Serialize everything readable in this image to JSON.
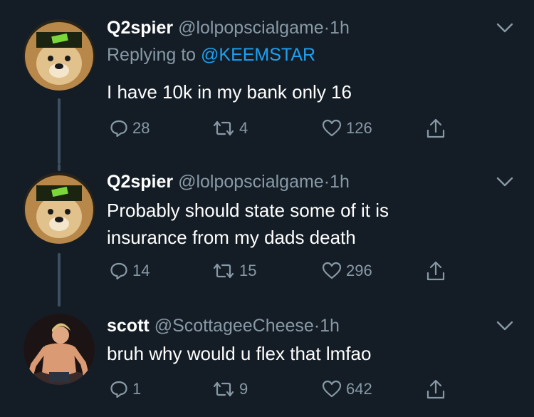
{
  "tweets": [
    {
      "name": "Q2spier",
      "handle": "@lolpopscialgame",
      "dot": "·",
      "time": "1h",
      "reply_prefix": "Replying to",
      "reply_to": "@KEEMSTAR",
      "text": "I have 10k in my bank only 16",
      "replies": "28",
      "retweets": "4",
      "likes": "126"
    },
    {
      "name": "Q2spier",
      "handle": "@lolpopscialgame",
      "dot": "·",
      "time": "1h",
      "text_lines": [
        "Probably should state some of it is",
        "insurance from my dads death"
      ],
      "replies": "14",
      "retweets": "15",
      "likes": "296"
    },
    {
      "name": "scott",
      "handle": "@ScottageeCheese",
      "dot": "·",
      "time": "1h",
      "text": "bruh why would u flex that lmfao",
      "replies": "1",
      "retweets": "9",
      "likes": "642"
    }
  ],
  "colors": {
    "background": "#141d26",
    "text_primary": "#ffffff",
    "text_secondary": "#8899a6",
    "link": "#1da1f2",
    "thread_line": "#3d4f60"
  },
  "icons": [
    "reply-icon",
    "retweet-icon",
    "like-icon",
    "share-icon",
    "chevron-down-icon"
  ]
}
